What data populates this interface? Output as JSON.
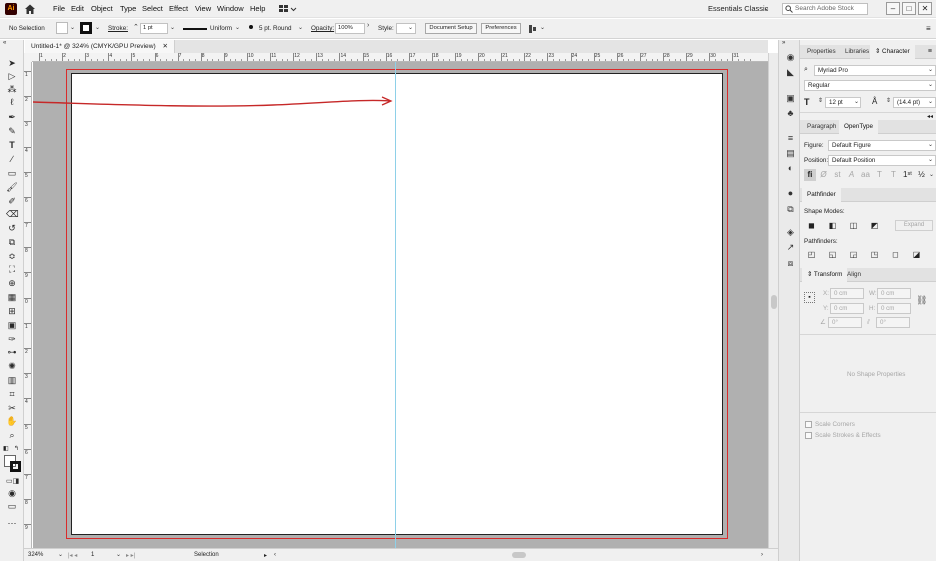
{
  "menu": {
    "items": [
      "File",
      "Edit",
      "Object",
      "Type",
      "Select",
      "Effect",
      "View",
      "Window",
      "Help"
    ]
  },
  "workspace": {
    "label": "Essentials Classic"
  },
  "search": {
    "placeholder": "Search Adobe Stock"
  },
  "control": {
    "selection": "No Selection",
    "stroke_label": "Stroke:",
    "stroke_value": "1 pt",
    "profile": "Uniform",
    "brush": "5 pt. Round",
    "opacity_label": "Opacity:",
    "opacity_value": "100%",
    "style_label": "Style:",
    "document_setup": "Document Setup",
    "preferences": "Preferences"
  },
  "document": {
    "tab_title": "Untitled-1* @ 324% (CMYK/GPU Preview)"
  },
  "ruler": {
    "h_ticks": [
      "1",
      "2",
      "3",
      "4",
      "5",
      "6",
      "7",
      "8",
      "9",
      "10",
      "11",
      "12",
      "13",
      "14",
      "15",
      "16",
      "17",
      "18",
      "19",
      "20",
      "21",
      "22",
      "23",
      "24",
      "25",
      "26",
      "27",
      "28",
      "29",
      "30",
      "31"
    ],
    "v_ticks": [
      "1",
      "2",
      "3",
      "4",
      "5",
      "6",
      "7",
      "8",
      "9",
      "0",
      "1",
      "2",
      "3",
      "4",
      "5",
      "6",
      "7",
      "8",
      "9"
    ]
  },
  "status": {
    "zoom": "324%",
    "artboard": "1",
    "mode": "Selection"
  },
  "panel": {
    "tabs": [
      "Properties",
      "Libraries",
      "Character"
    ],
    "font_family": "Myriad Pro",
    "font_style": "Regular",
    "font_size": "12 pt",
    "leading": "(14.4 pt)",
    "tabs2": [
      "Paragraph",
      "OpenType"
    ],
    "figure_label": "Figure:",
    "figure_value": "Default Figure",
    "position_label": "Position:",
    "position_value": "Default Position",
    "pathfinder_tab": "Pathfinder",
    "shape_modes": "Shape Modes:",
    "expand": "Expand",
    "pathfinders": "Pathfinders:",
    "tabs3": [
      "Transform",
      "Align"
    ],
    "x_label": "X:",
    "x_value": "0 cm",
    "y_label": "Y:",
    "y_value": "0 cm",
    "w_label": "W:",
    "w_value": "0 cm",
    "h_label": "H:",
    "h_value": "0 cm",
    "angle_value": "0°",
    "shear_value": "0°",
    "no_shape": "No Shape Properties",
    "scale_corners": "Scale Corners",
    "scale_strokes": "Scale Strokes & Effects"
  },
  "colors": {
    "artboard_border": "#d92b2b",
    "guide": "#8ed0e8",
    "arrow": "#c62828",
    "canvas_bg": "#b0b0b0"
  }
}
